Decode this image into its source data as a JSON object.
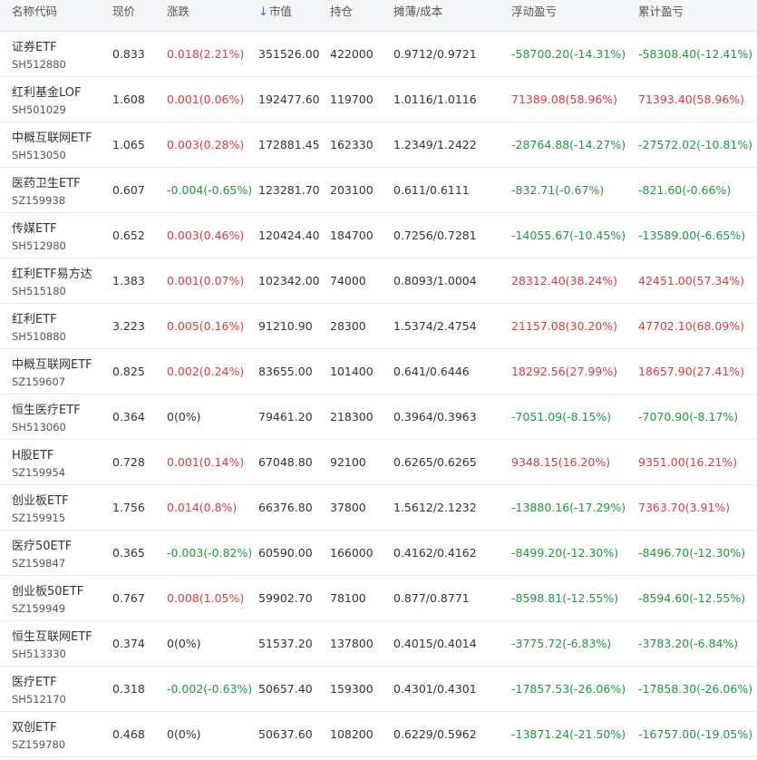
{
  "colors": {
    "up": "#e03a3a",
    "down": "#1e9a3c",
    "neutral": "#333333",
    "sort_arrow": "#2f7ad8",
    "header_bg": "#f5f6f8"
  },
  "header": {
    "name_code": "名称代码",
    "price": "现价",
    "change": "涨跌",
    "sort_icon": "↓",
    "market_value": "市值",
    "holding": "持仓",
    "cost": "摊薄/成本",
    "floating_pl": "浮动盈亏",
    "cumulative_pl": "累计盈亏"
  },
  "rows": [
    {
      "name": "证券ETF",
      "code": "SH512880",
      "price": "0.833",
      "change": "0.018(2.21%)",
      "change_dir": "up",
      "market_value": "351526.00",
      "holding": "422000",
      "cost": "0.9712/0.9721",
      "floating_pl": "-58700.20(-14.31%)",
      "floating_dir": "down",
      "cumulative_pl": "-58308.40(-12.41%)",
      "cumulative_dir": "down"
    },
    {
      "name": "红利基金LOF",
      "code": "SH501029",
      "price": "1.608",
      "change": "0.001(0.06%)",
      "change_dir": "up",
      "market_value": "192477.60",
      "holding": "119700",
      "cost": "1.0116/1.0116",
      "floating_pl": "71389.08(58.96%)",
      "floating_dir": "up",
      "cumulative_pl": "71393.40(58.96%)",
      "cumulative_dir": "up"
    },
    {
      "name": "中概互联网ETF",
      "code": "SH513050",
      "price": "1.065",
      "change": "0.003(0.28%)",
      "change_dir": "up",
      "market_value": "172881.45",
      "holding": "162330",
      "cost": "1.2349/1.2422",
      "floating_pl": "-28764.88(-14.27%)",
      "floating_dir": "down",
      "cumulative_pl": "-27572.02(-10.81%)",
      "cumulative_dir": "down"
    },
    {
      "name": "医药卫生ETF",
      "code": "SZ159938",
      "price": "0.607",
      "change": "-0.004(-0.65%)",
      "change_dir": "down",
      "market_value": "123281.70",
      "holding": "203100",
      "cost": "0.611/0.6111",
      "floating_pl": "-832.71(-0.67%)",
      "floating_dir": "down",
      "cumulative_pl": "-821.60(-0.66%)",
      "cumulative_dir": "down"
    },
    {
      "name": "传媒ETF",
      "code": "SH512980",
      "price": "0.652",
      "change": "0.003(0.46%)",
      "change_dir": "up",
      "market_value": "120424.40",
      "holding": "184700",
      "cost": "0.7256/0.7281",
      "floating_pl": "-14055.67(-10.45%)",
      "floating_dir": "down",
      "cumulative_pl": "-13589.00(-6.65%)",
      "cumulative_dir": "down"
    },
    {
      "name": "红利ETF易方达",
      "code": "SH515180",
      "price": "1.383",
      "change": "0.001(0.07%)",
      "change_dir": "up",
      "market_value": "102342.00",
      "holding": "74000",
      "cost": "0.8093/1.0004",
      "floating_pl": "28312.40(38.24%)",
      "floating_dir": "up",
      "cumulative_pl": "42451.00(57.34%)",
      "cumulative_dir": "up"
    },
    {
      "name": "红利ETF",
      "code": "SH510880",
      "price": "3.223",
      "change": "0.005(0.16%)",
      "change_dir": "up",
      "market_value": "91210.90",
      "holding": "28300",
      "cost": "1.5374/2.4754",
      "floating_pl": "21157.08(30.20%)",
      "floating_dir": "up",
      "cumulative_pl": "47702.10(68.09%)",
      "cumulative_dir": "up"
    },
    {
      "name": "中概互联网ETF",
      "code": "SZ159607",
      "price": "0.825",
      "change": "0.002(0.24%)",
      "change_dir": "up",
      "market_value": "83655.00",
      "holding": "101400",
      "cost": "0.641/0.6446",
      "floating_pl": "18292.56(27.99%)",
      "floating_dir": "up",
      "cumulative_pl": "18657.90(27.41%)",
      "cumulative_dir": "up"
    },
    {
      "name": "恒生医疗ETF",
      "code": "SH513060",
      "price": "0.364",
      "change": "0(0%)",
      "change_dir": "flat",
      "market_value": "79461.20",
      "holding": "218300",
      "cost": "0.3964/0.3963",
      "floating_pl": "-7051.09(-8.15%)",
      "floating_dir": "down",
      "cumulative_pl": "-7070.90(-8.17%)",
      "cumulative_dir": "down"
    },
    {
      "name": "H股ETF",
      "code": "SZ159954",
      "price": "0.728",
      "change": "0.001(0.14%)",
      "change_dir": "up",
      "market_value": "67048.80",
      "holding": "92100",
      "cost": "0.6265/0.6265",
      "floating_pl": "9348.15(16.20%)",
      "floating_dir": "up",
      "cumulative_pl": "9351.00(16.21%)",
      "cumulative_dir": "up"
    },
    {
      "name": "创业板ETF",
      "code": "SZ159915",
      "price": "1.756",
      "change": "0.014(0.8%)",
      "change_dir": "up",
      "market_value": "66376.80",
      "holding": "37800",
      "cost": "1.5612/2.1232",
      "floating_pl": "-13880.16(-17.29%)",
      "floating_dir": "down",
      "cumulative_pl": "7363.70(3.91%)",
      "cumulative_dir": "up"
    },
    {
      "name": "医疗50ETF",
      "code": "SZ159847",
      "price": "0.365",
      "change": "-0.003(-0.82%)",
      "change_dir": "down",
      "market_value": "60590.00",
      "holding": "166000",
      "cost": "0.4162/0.4162",
      "floating_pl": "-8499.20(-12.30%)",
      "floating_dir": "down",
      "cumulative_pl": "-8496.70(-12.30%)",
      "cumulative_dir": "down"
    },
    {
      "name": "创业板50ETF",
      "code": "SZ159949",
      "price": "0.767",
      "change": "0.008(1.05%)",
      "change_dir": "up",
      "market_value": "59902.70",
      "holding": "78100",
      "cost": "0.877/0.8771",
      "floating_pl": "-8598.81(-12.55%)",
      "floating_dir": "down",
      "cumulative_pl": "-8594.60(-12.55%)",
      "cumulative_dir": "down"
    },
    {
      "name": "恒生互联网ETF",
      "code": "SH513330",
      "price": "0.374",
      "change": "0(0%)",
      "change_dir": "flat",
      "market_value": "51537.20",
      "holding": "137800",
      "cost": "0.4015/0.4014",
      "floating_pl": "-3775.72(-6.83%)",
      "floating_dir": "down",
      "cumulative_pl": "-3783.20(-6.84%)",
      "cumulative_dir": "down"
    },
    {
      "name": "医疗ETF",
      "code": "SH512170",
      "price": "0.318",
      "change": "-0.002(-0.63%)",
      "change_dir": "down",
      "market_value": "50657.40",
      "holding": "159300",
      "cost": "0.4301/0.4301",
      "floating_pl": "-17857.53(-26.06%)",
      "floating_dir": "down",
      "cumulative_pl": "-17858.30(-26.06%)",
      "cumulative_dir": "down"
    },
    {
      "name": "双创ETF",
      "code": "SZ159780",
      "price": "0.468",
      "change": "0(0%)",
      "change_dir": "flat",
      "market_value": "50637.60",
      "holding": "108200",
      "cost": "0.6229/0.5962",
      "floating_pl": "-13871.24(-21.50%)",
      "floating_dir": "down",
      "cumulative_pl": "-16757.00(-19.05%)",
      "cumulative_dir": "down"
    }
  ]
}
